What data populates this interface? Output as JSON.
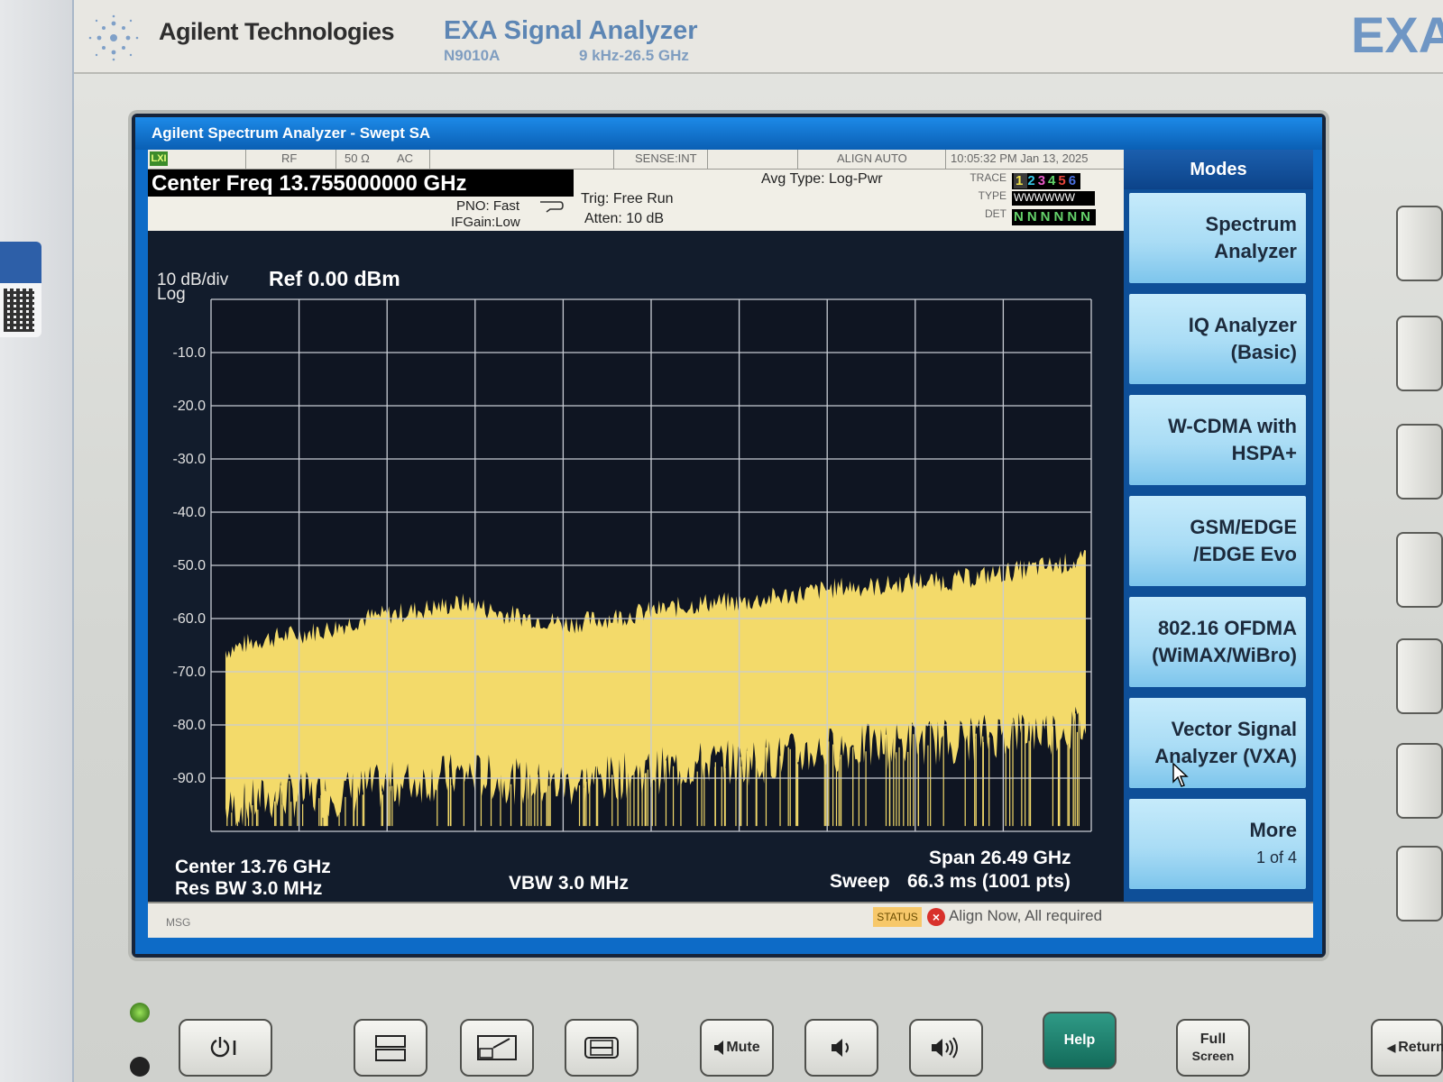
{
  "header": {
    "brand": "Agilent Technologies",
    "product_name": "EXA Signal Analyzer",
    "model": "N9010A",
    "freq_range": "9 kHz-26.5 GHz",
    "big_mark": "EXA"
  },
  "window": {
    "title": "Agilent Spectrum Analyzer - Swept SA"
  },
  "status_strip": {
    "lxi": "LXI",
    "rf": "RF",
    "impedance": "50 Ω",
    "coupling": "AC",
    "sense": "SENSE:INT",
    "align": "ALIGN AUTO",
    "datetime": "10:05:32 PM Jan 13, 2025"
  },
  "info": {
    "center_freq": "Center Freq 13.755000000 GHz",
    "pno": "PNO: Fast",
    "ifgain": "IFGain:Low",
    "trig": "Trig: Free Run",
    "atten": "Atten: 10 dB",
    "avg_type": "Avg Type: Log-Pwr",
    "trace_label": "TRACE",
    "type_label": "TYPE",
    "det_label": "DET",
    "trace_numbers": [
      "1",
      "2",
      "3",
      "4",
      "5",
      "6"
    ],
    "trace_colors": [
      "#f2e34a",
      "#38c8e8",
      "#e85bc8",
      "#62d46a",
      "#e8463c",
      "#4a70e0"
    ],
    "trace_type": "WWWWWW",
    "trace_det": "NNNNNN"
  },
  "display": {
    "scale_per_div": "10 dB/div",
    "scale_type": "Log",
    "ref_level": "Ref 0.00 dBm",
    "center": "Center 13.76 GHz",
    "res_bw": "Res BW 3.0 MHz",
    "vbw": "VBW 3.0 MHz",
    "span": "Span 26.49 GHz",
    "sweep_label": "Sweep",
    "sweep_value": "66.3 ms (1001 pts)",
    "trace_color": "#f3da6a",
    "grid_color": "#c8ccd4"
  },
  "chart_data": {
    "type": "line",
    "y_tick_labels": [
      "-10.0",
      "-20.0",
      "-30.0",
      "-40.0",
      "-50.0",
      "-60.0",
      "-70.0",
      "-80.0",
      "-90.0"
    ],
    "ylim": [
      -100,
      0
    ],
    "xlim_ghz": [
      0.5105,
      27.0
    ],
    "grid": true,
    "series": [
      {
        "upper_envelope_dbm": [
          -66,
          -64,
          -63,
          -62,
          -60,
          -59,
          -58,
          -57,
          -59,
          -60,
          -61,
          -60,
          -59,
          -58,
          -57,
          -57,
          -56,
          -55,
          -54,
          -54,
          -53,
          -53,
          -52,
          -51,
          -50,
          -49
        ],
        "lower_envelope_dbm": [
          -98,
          -96,
          -95,
          -95,
          -94,
          -93,
          -92,
          -91,
          -92,
          -93,
          -93,
          -92,
          -91,
          -90,
          -89,
          -89,
          -88,
          -87,
          -86,
          -86,
          -85,
          -85,
          -84,
          -83,
          -83,
          -82
        ]
      }
    ]
  },
  "status_bar": {
    "msg_label": "MSG",
    "status_tag": "STATUS",
    "status_message": "Align Now, All required"
  },
  "softkeys": {
    "header": "Modes",
    "items": [
      {
        "line1": "Spectrum",
        "line2": "Analyzer"
      },
      {
        "line1": "IQ Analyzer",
        "line2": "(Basic)"
      },
      {
        "line1": "W-CDMA with",
        "line2": "HSPA+"
      },
      {
        "line1": "GSM/EDGE",
        "line2": "/EDGE Evo"
      },
      {
        "line1": "802.16 OFDMA",
        "line2": "(WiMAX/WiBro)"
      },
      {
        "line1": "Vector Signal",
        "line2": "Analyzer (VXA)"
      },
      {
        "line1": "More",
        "line2": "1 of 4"
      }
    ]
  },
  "front_panel": {
    "mute": "Mute",
    "help": "Help",
    "full_screen_1": "Full",
    "full_screen_2": "Screen",
    "return": "Return",
    "power_icon": "power-icon",
    "speaker_down_icon": "volume-down-icon",
    "speaker_up_icon": "volume-up-icon"
  }
}
